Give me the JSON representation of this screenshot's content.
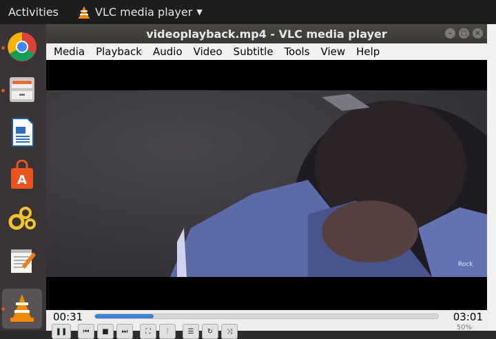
{
  "topbar": {
    "activities": "Activities",
    "app_name": "VLC media player"
  },
  "dock": {
    "items": [
      {
        "name": "chrome"
      },
      {
        "name": "files"
      },
      {
        "name": "writer"
      },
      {
        "name": "software"
      },
      {
        "name": "settings"
      },
      {
        "name": "text-editor"
      },
      {
        "name": "vlc"
      }
    ]
  },
  "window": {
    "title": "videoplayback.mp4 - VLC media player",
    "menu": [
      {
        "label": "Media"
      },
      {
        "label": "Playback"
      },
      {
        "label": "Audio"
      },
      {
        "label": "Video"
      },
      {
        "label": "Subtitle"
      },
      {
        "label": "Tools"
      },
      {
        "label": "View"
      },
      {
        "label": "Help"
      }
    ],
    "watermark": "Rock"
  },
  "player": {
    "current_time": "00:31",
    "total_time": "03:01",
    "progress": 0.17,
    "volume": "50%"
  },
  "colors": {
    "accent": "#3b80d1",
    "topbar": "#1d1d1d",
    "dock": "#3a3436"
  }
}
